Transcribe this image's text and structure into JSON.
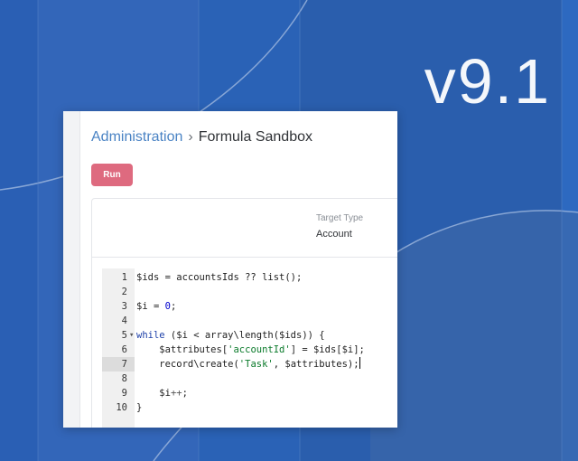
{
  "banner": {
    "version": "v9.1"
  },
  "breadcrumb": {
    "root": "Administration",
    "separator": "›",
    "current": "Formula Sandbox"
  },
  "toolbar": {
    "run_label": "Run"
  },
  "fields": {
    "target_type_label": "Target Type",
    "target_type_value": "Account"
  },
  "editor": {
    "active_line": 7,
    "lines": [
      {
        "num": "1",
        "text": "$ids = accountsIds ?? list();"
      },
      {
        "num": "2",
        "text": ""
      },
      {
        "num": "3",
        "text": "$i = 0;"
      },
      {
        "num": "4",
        "text": ""
      },
      {
        "num": "5",
        "text": "while ($i < array\\length($ids)) {"
      },
      {
        "num": "6",
        "text": "    $attributes['accountId'] = $ids[$i];"
      },
      {
        "num": "7",
        "text": "    record\\create('Task', $attributes);"
      },
      {
        "num": "8",
        "text": ""
      },
      {
        "num": "9",
        "text": "    $i++;"
      },
      {
        "num": "10",
        "text": "}"
      }
    ]
  }
}
